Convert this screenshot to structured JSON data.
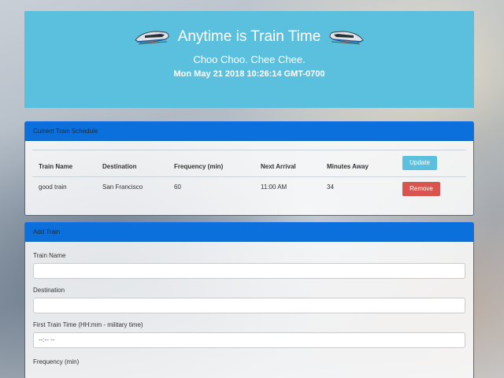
{
  "header": {
    "title": "Anytime is Train Time",
    "subtitle": "Choo Choo. Chee Chee.",
    "datetime": "Mon May 21 2018 10:26:14 GMT-0700"
  },
  "schedule": {
    "heading": "Current Train Schedule",
    "columns": [
      "Train Name",
      "Destination",
      "Frequency (min)",
      "Next Arrival",
      "Minutes Away"
    ],
    "update_label": "Update",
    "remove_label": "Remove",
    "rows": [
      {
        "name": "good train",
        "destination": "San Francisco",
        "frequency": "60",
        "next_arrival": "11:00 AM",
        "minutes_away": "34"
      }
    ]
  },
  "add_train": {
    "heading": "Add Train",
    "fields": [
      {
        "label": "Train Name",
        "value": ""
      },
      {
        "label": "Destination",
        "value": ""
      },
      {
        "label": "First Train Time (HH:mm - military time)",
        "value": "--:-- --"
      },
      {
        "label": "Frequency (min)",
        "value": ""
      }
    ]
  },
  "icons": [
    "train-icon-left",
    "train-icon-right"
  ],
  "colors": {
    "jumbotron": "#5bc0de",
    "panel_heading": "#0b6fdc",
    "update_button": "#5bc0de",
    "remove_button": "#d9534f"
  }
}
